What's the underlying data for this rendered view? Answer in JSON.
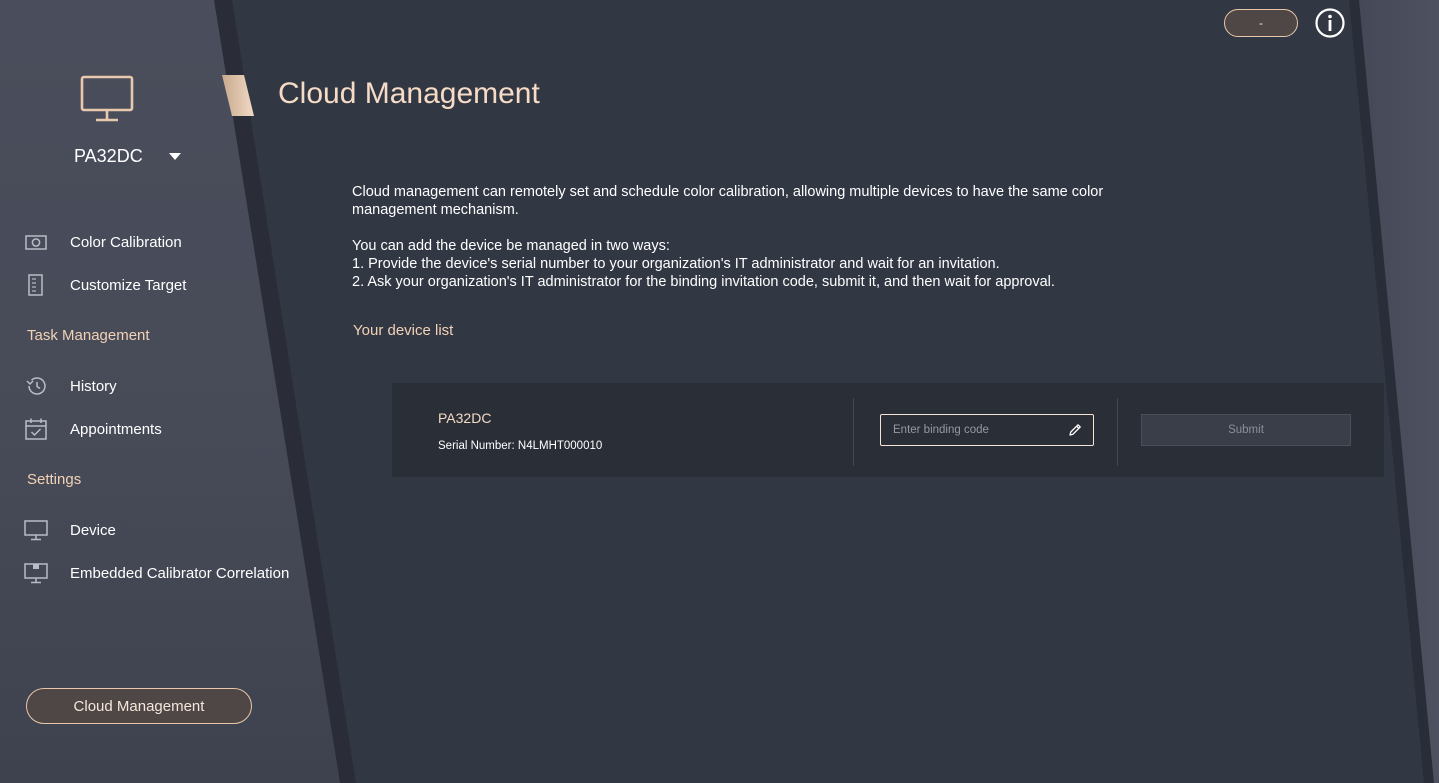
{
  "header": {
    "pill_label": "-",
    "info_icon": "info-icon"
  },
  "sidebar": {
    "device_name": "PA32DC",
    "items_top": [
      {
        "label": "Color Calibration",
        "icon": "camera-icon"
      },
      {
        "label": "Customize Target",
        "icon": "document-icon"
      }
    ],
    "task_section": "Task Management",
    "items_task": [
      {
        "label": "History",
        "icon": "history-icon"
      },
      {
        "label": "Appointments",
        "icon": "calendar-icon"
      }
    ],
    "settings_section": "Settings",
    "items_settings": [
      {
        "label": "Device",
        "icon": "monitor-icon"
      },
      {
        "label": "Embedded Calibrator Correlation",
        "icon": "monitor-calibrator-icon"
      }
    ],
    "active_button": "Cloud Management"
  },
  "main": {
    "title": "Cloud Management",
    "description_1": "Cloud management can remotely set and schedule color calibration, allowing multiple devices to have the same color management mechanism.",
    "description_2": "You can add the device be managed in two ways:",
    "description_3": "1. Provide the device's serial number to your organization's IT administrator and wait for an invitation.",
    "description_4": "2. Ask your organization's IT administrator for the binding invitation code, submit it, and then wait for approval.",
    "device_list_label": "Your device list",
    "devices": [
      {
        "name": "PA32DC",
        "serial": "Serial Number: N4LMHT000010",
        "binding_placeholder": "Enter binding code",
        "binding_value": "",
        "submit_label": "Submit"
      }
    ]
  },
  "colors": {
    "accent": "#f2d2b6",
    "background": "#323744",
    "sidebar": "#4a4e5c"
  }
}
